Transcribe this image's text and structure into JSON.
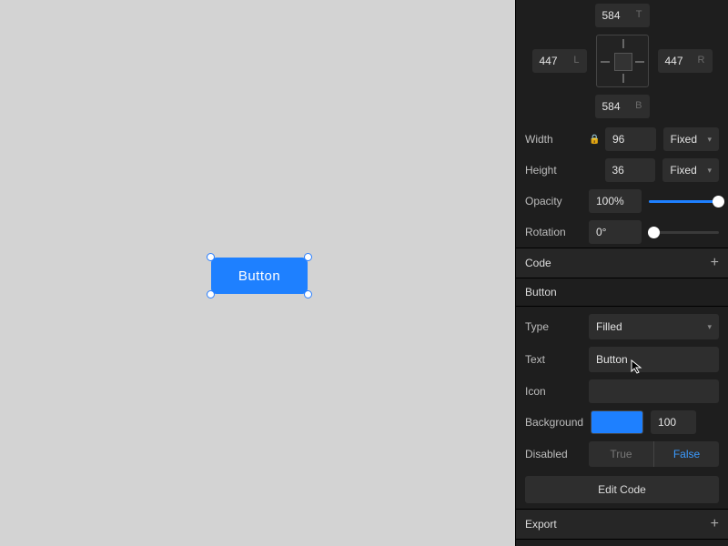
{
  "canvas": {
    "button_label": "Button"
  },
  "constraints": {
    "top": "584",
    "bottom": "584",
    "left": "447",
    "right": "447",
    "suffix_t": "T",
    "suffix_b": "B",
    "suffix_l": "L",
    "suffix_r": "R"
  },
  "size": {
    "width_label": "Width",
    "width_value": "96",
    "width_mode": "Fixed",
    "height_label": "Height",
    "height_value": "36",
    "height_mode": "Fixed"
  },
  "opacity": {
    "label": "Opacity",
    "value": "100%"
  },
  "rotation": {
    "label": "Rotation",
    "value": "0°"
  },
  "code": {
    "header": "Code",
    "component": "Button",
    "type_label": "Type",
    "type_value": "Filled",
    "text_label": "Text",
    "text_value": "Button",
    "icon_label": "Icon",
    "icon_value": "",
    "background_label": "Background",
    "background_hex": "#1e80ff",
    "background_opacity": "100",
    "disabled_label": "Disabled",
    "disabled_true": "True",
    "disabled_false": "False",
    "edit_code": "Edit Code"
  },
  "export": {
    "header": "Export"
  }
}
